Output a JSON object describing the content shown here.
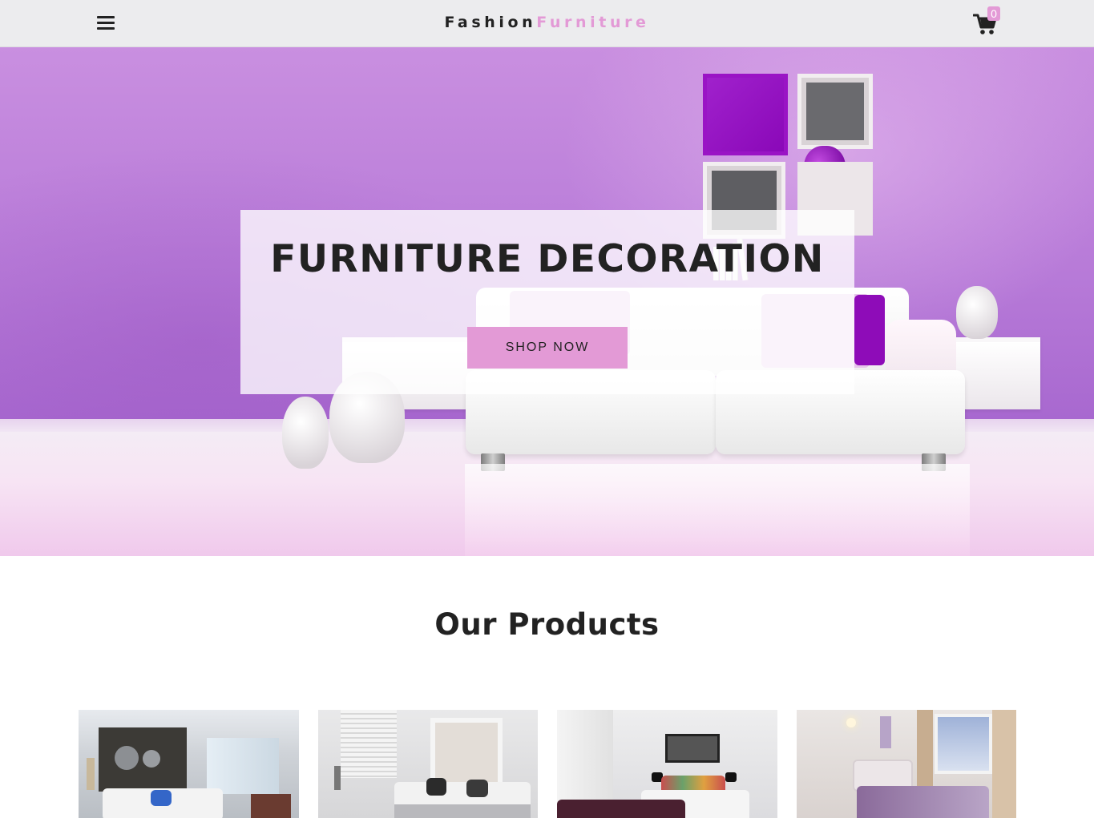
{
  "header": {
    "brand_part1": "Fashion",
    "brand_part2": "Furniture",
    "menu_icon": "hamburger-menu-icon",
    "cart_icon": "shopping-cart-icon",
    "cart_count": "0"
  },
  "hero": {
    "title": "FURNITURE DECORATION",
    "cta_label": "SHOP NOW"
  },
  "products": {
    "title": "Our Products",
    "items": [
      {
        "image": "bedroom-photo-1"
      },
      {
        "image": "bedroom-photo-2"
      },
      {
        "image": "bedroom-photo-3"
      },
      {
        "image": "bedroom-photo-4"
      }
    ]
  },
  "colors": {
    "accent": "#e39ad6",
    "hero_wall": "#b77ad8",
    "header_bg": "#ececee",
    "text": "#222222"
  }
}
